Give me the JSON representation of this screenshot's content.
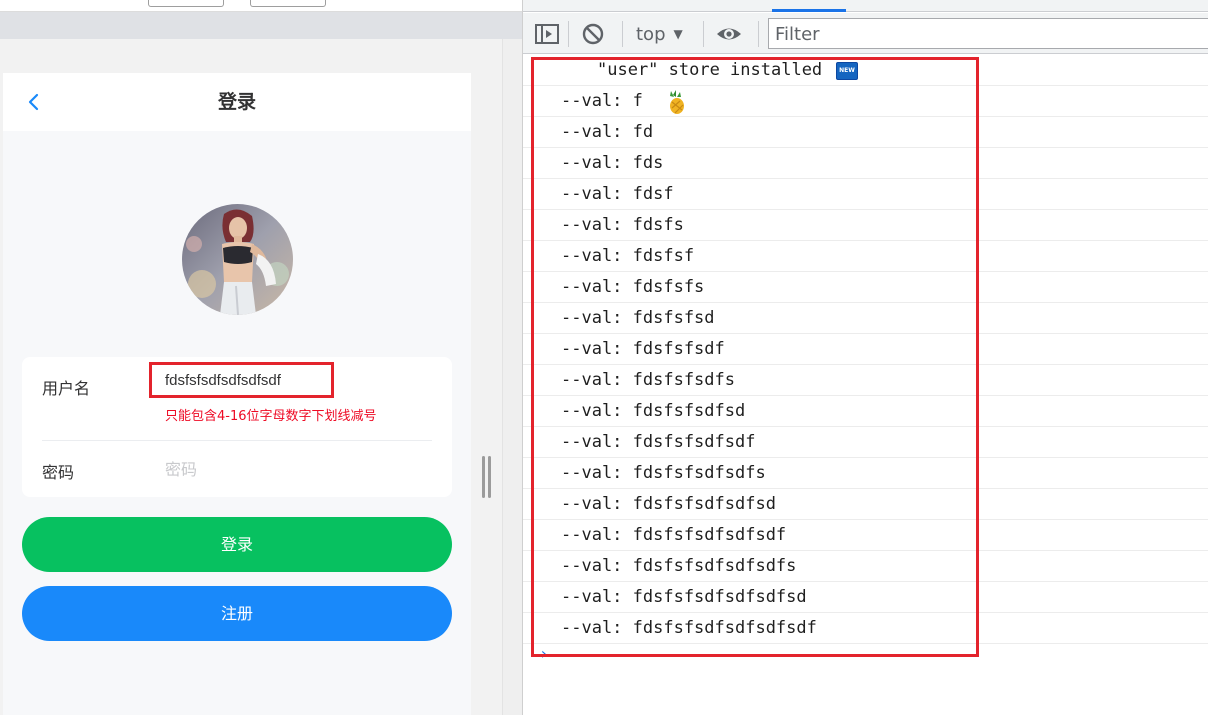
{
  "app": {
    "page_title": "登录",
    "back_icon": "chevron-left-icon",
    "avatar": "profile-avatar-image"
  },
  "login_form": {
    "username_label": "用户名",
    "username_value": "fdsfsfsdfsdfsdfsdf",
    "username_error": "只能包含4-16位字母数字下划线减号",
    "password_label": "密码",
    "password_placeholder": "密码"
  },
  "buttons": {
    "login_label": "登录",
    "register_label": "注册"
  },
  "devtools": {
    "toolbar": {
      "sidebar_icon": "sidebar-toggle-icon",
      "clear_icon": "clear-console-icon",
      "context": "top",
      "eye_icon": "live-expression-eye-icon",
      "filter_placeholder": "Filter"
    },
    "console_logs": [
      "\"user\" store installed",
      "--val: f",
      "--val: fd",
      "--val: fds",
      "--val: fdsf",
      "--val: fdsfs",
      "--val: fdsfsf",
      "--val: fdsfsfs",
      "--val: fdsfsfsd",
      "--val: fdsfsfsdf",
      "--val: fdsfsfsdfs",
      "--val: fdsfsfsdfsd",
      "--val: fdsfsfsdfsdf",
      "--val: fdsfsfsdfsdfs",
      "--val: fdsfsfsdfsdfsd",
      "--val: fdsfsfsdfsdfsdf",
      "--val: fdsfsfsdfsdfsdfs",
      "--val: fdsfsfsdfsdfsdfsd",
      "--val: fdsfsfsdfsdfsdfsdf"
    ],
    "badge_text": "NEW",
    "prompt_symbol": "›"
  },
  "colors": {
    "highlight": "#e3232c",
    "login_button": "#07c160",
    "register_button": "#1989fa",
    "error_text": "#ee0a24",
    "devtools_accent": "#1a73e8"
  }
}
